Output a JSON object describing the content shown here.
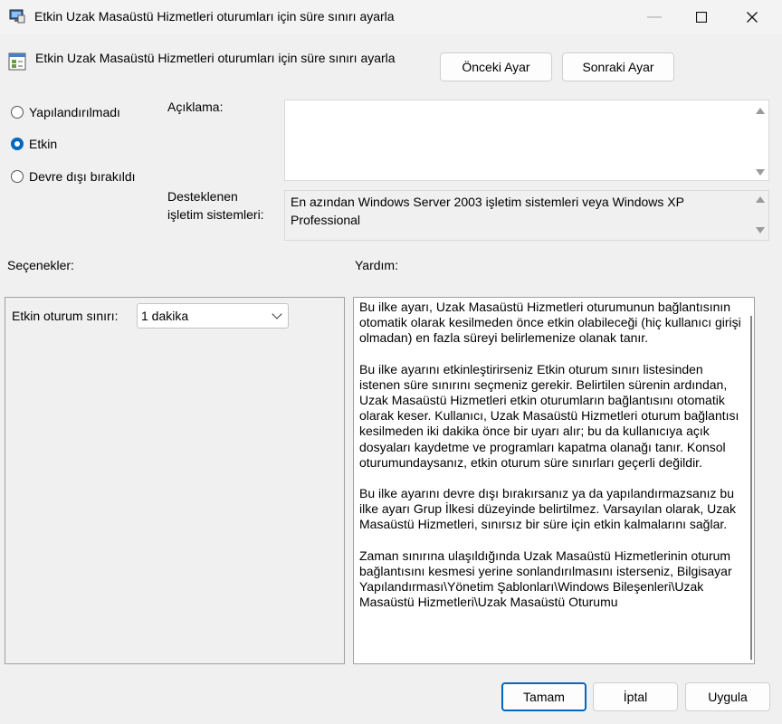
{
  "window": {
    "title": "Etkin Uzak Masaüstü Hizmetleri oturumları için süre sınırı ayarla",
    "minimize_icon": "minimize-icon",
    "maximize_icon": "maximize-icon",
    "close_icon": "close-icon"
  },
  "header": {
    "policy_title": "Etkin Uzak Masaüstü Hizmetleri oturumları için süre sınırı ayarla",
    "prev_button": "Önceki Ayar",
    "next_button": "Sonraki Ayar"
  },
  "state": {
    "options": [
      "Yapılandırılmadı",
      "Etkin",
      "Devre dışı bırakıldı"
    ],
    "selected": "Etkin"
  },
  "description": {
    "label": "Açıklama:",
    "text": ""
  },
  "supported": {
    "label_line1": "Desteklenen",
    "label_line2": "işletim sistemleri:",
    "text": "En azından Windows Server 2003 işletim sistemleri veya Windows XP Professional"
  },
  "options_section": {
    "label": "Seçenekler:",
    "session_limit_label": "Etkin oturum sınırı:",
    "session_limit_value": "1 dakika"
  },
  "help_section": {
    "label": "Yardım:",
    "paragraphs": [
      "Bu ilke ayarı, Uzak Masaüstü Hizmetleri oturumunun bağlantısının otomatik olarak kesilmeden önce etkin olabileceği (hiç kullanıcı girişi olmadan) en fazla süreyi belirlemenize olanak tanır.",
      "Bu ilke ayarını etkinleştirirseniz Etkin oturum sınırı listesinden istenen süre sınırını seçmeniz gerekir. Belirtilen sürenin ardından, Uzak Masaüstü Hizmetleri etkin oturumların bağlantısını otomatik olarak keser. Kullanıcı, Uzak Masaüstü Hizmetleri oturum bağlantısı kesilmeden iki dakika önce bir uyarı alır; bu da kullanıcıya açık dosyaları kaydetme ve programları kapatma olanağı tanır. Konsol oturumundaysanız, etkin oturum süre sınırları geçerli değildir.",
      "Bu ilke ayarını devre dışı bırakırsanız ya da yapılandırmazsanız bu ilke ayarı Grup İlkesi düzeyinde belirtilmez. Varsayılan olarak, Uzak Masaüstü Hizmetleri, sınırsız bir süre için etkin kalmalarını sağlar.",
      "Zaman sınırına ulaşıldığında Uzak Masaüstü Hizmetlerinin oturum bağlantısını kesmesi yerine sonlandırılmasını isterseniz, Bilgisayar Yapılandırması\\Yönetim Şablonları\\Windows Bileşenleri\\Uzak Masaüstü Hizmetleri\\Uzak Masaüstü Oturumu"
    ]
  },
  "footer": {
    "ok": "Tamam",
    "cancel": "İptal",
    "apply": "Uygula"
  },
  "colors": {
    "accent": "#0067c0",
    "background": "#f0f0f0"
  }
}
